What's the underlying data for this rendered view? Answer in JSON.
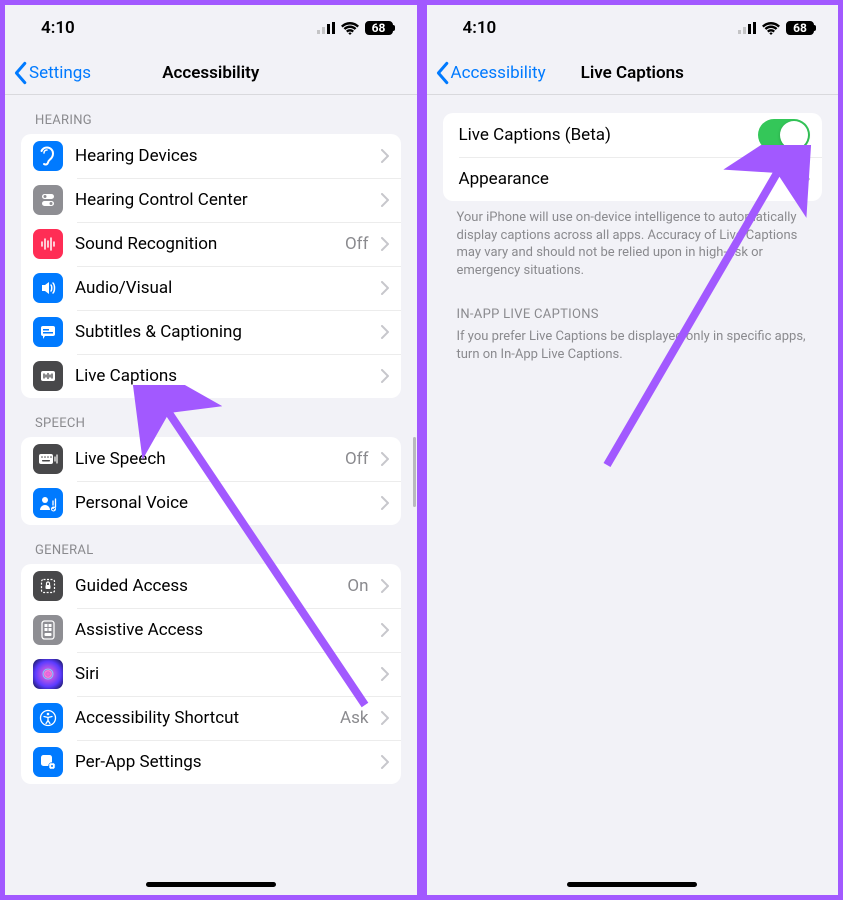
{
  "status": {
    "time": "4:10",
    "battery": "68"
  },
  "left": {
    "back": "Settings",
    "title": "Accessibility",
    "sections": {
      "hearing": {
        "header": "HEARING",
        "items": [
          {
            "label": "Hearing Devices"
          },
          {
            "label": "Hearing Control Center"
          },
          {
            "label": "Sound Recognition",
            "value": "Off"
          },
          {
            "label": "Audio/Visual"
          },
          {
            "label": "Subtitles & Captioning"
          },
          {
            "label": "Live Captions"
          }
        ]
      },
      "speech": {
        "header": "SPEECH",
        "items": [
          {
            "label": "Live Speech",
            "value": "Off"
          },
          {
            "label": "Personal Voice"
          }
        ]
      },
      "general": {
        "header": "GENERAL",
        "items": [
          {
            "label": "Guided Access",
            "value": "On"
          },
          {
            "label": "Assistive Access"
          },
          {
            "label": "Siri"
          },
          {
            "label": "Accessibility Shortcut",
            "value": "Ask"
          },
          {
            "label": "Per-App Settings"
          }
        ]
      }
    }
  },
  "right": {
    "back": "Accessibility",
    "title": "Live Captions",
    "items": [
      {
        "label": "Live Captions (Beta)"
      },
      {
        "label": "Appearance"
      }
    ],
    "footer1": "Your iPhone will use on-device intelligence to automatically display captions across all apps. Accuracy of Live Captions may vary and should not be relied upon in high-risk or emergency situations.",
    "header2": "IN-APP LIVE CAPTIONS",
    "footer2": "If you prefer Live Captions be displayed only in specific apps, turn on In-App Live Captions."
  }
}
